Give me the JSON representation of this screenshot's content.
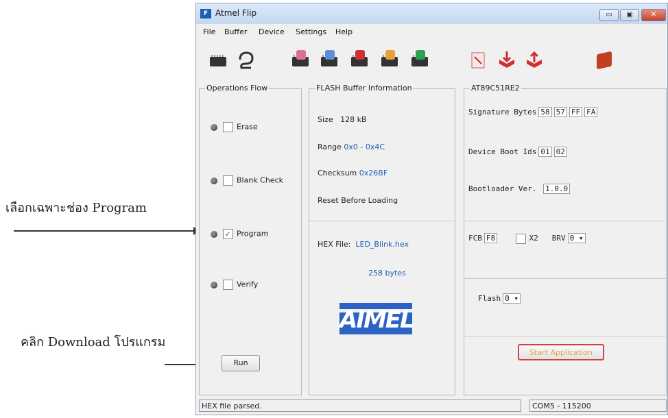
{
  "annotations": {
    "select_program": "เลือกเฉพาะช่อง Program",
    "click_download": "คลิก Download โปรแกรม"
  },
  "window": {
    "title": "Atmel Flip"
  },
  "menu": [
    "File",
    "Buffer",
    "Device",
    "Settings",
    "Help"
  ],
  "operations": {
    "title": "Operations Flow",
    "items": [
      {
        "label": "Erase",
        "checked": false
      },
      {
        "label": "Blank Check",
        "checked": false
      },
      {
        "label": "Program",
        "checked": true
      },
      {
        "label": "Verify",
        "checked": false
      }
    ],
    "run_label": "Run"
  },
  "buffer": {
    "title": "FLASH Buffer Information",
    "size_label": "Size",
    "size_value": "128 kB",
    "range_label": "Range",
    "range_value": "0x0 - 0x4C",
    "checksum_label": "Checksum",
    "checksum_value": "0x26BF",
    "reset_label": "Reset Before Loading",
    "hex_label": "HEX File:",
    "hex_value": "LED_Blink.hex",
    "bytes_value": "258 bytes",
    "logo_text": "AIMEL"
  },
  "device": {
    "title": "AT89C51RE2",
    "signature_label": "Signature Bytes",
    "signature_values": [
      "58",
      "57",
      "FF",
      "FA"
    ],
    "boot_ids_label": "Device Boot Ids",
    "boot_ids_values": [
      "01",
      "02"
    ],
    "bootloader_label": "Bootloader Ver.",
    "bootloader_value": "1.0.0",
    "fcb_label": "FCB",
    "fcb_value": "F8",
    "x2_label": "X2",
    "brv_label": "BRV",
    "brv_value": "0",
    "flash_label": "Flash",
    "flash_value": "0",
    "start_label": "Start Application"
  },
  "status": {
    "left": "HEX file parsed.",
    "right": "COM5 - 115200"
  },
  "colors": {
    "value_blue": "#1f5fb0",
    "start_border": "#d04040",
    "start_text": "#e8a040"
  }
}
